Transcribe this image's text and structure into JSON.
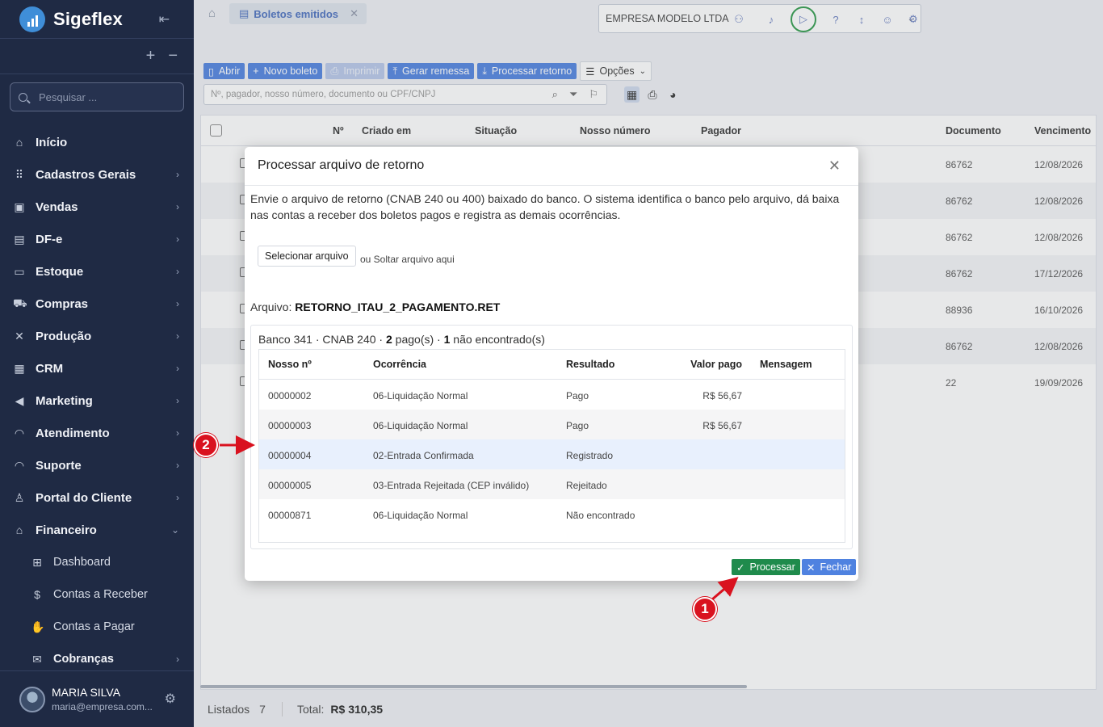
{
  "app": {
    "name": "Sigeflex"
  },
  "sidebar": {
    "search_placeholder": "Pesquisar ...",
    "items": [
      {
        "label": "Início",
        "icon": "home-icon"
      },
      {
        "label": "Cadastros Gerais",
        "icon": "grid-icon"
      },
      {
        "label": "Vendas",
        "icon": "bag-icon"
      },
      {
        "label": "DF-e",
        "icon": "document-icon"
      },
      {
        "label": "Estoque",
        "icon": "box-icon"
      },
      {
        "label": "Compras",
        "icon": "truck-icon"
      },
      {
        "label": "Produção",
        "icon": "tools-icon"
      },
      {
        "label": "CRM",
        "icon": "briefcase-icon"
      },
      {
        "label": "Marketing",
        "icon": "megaphone-icon"
      },
      {
        "label": "Atendimento",
        "icon": "headset-icon"
      },
      {
        "label": "Suporte",
        "icon": "support-icon"
      },
      {
        "label": "Portal do Cliente",
        "icon": "user-icon"
      },
      {
        "label": "Financeiro",
        "icon": "bank-icon"
      }
    ],
    "subitems": [
      {
        "label": "Dashboard",
        "icon": "dashboard-icon"
      },
      {
        "label": "Contas a Receber",
        "icon": "coin-icon"
      },
      {
        "label": "Contas a Pagar",
        "icon": "hand-coin-icon"
      },
      {
        "label": "Cobranças",
        "icon": "mail-icon"
      }
    ],
    "user": {
      "name": "MARIA SILVA",
      "email": "maria@empresa.com..."
    }
  },
  "topbar": {
    "tab_label": "Boletos emitidos",
    "company": "EMPRESA MODELO LTDA"
  },
  "toolbar": {
    "abrir": "Abrir",
    "novo_boleto": "Novo boleto",
    "imprimir": "Imprimir",
    "gerar_remessa": "Gerar remessa",
    "processar_retorno": "Processar retorno",
    "opcoes": "Opções",
    "filter_placeholder": "Nº, pagador, nosso número, documento ou CPF/CNPJ"
  },
  "grid": {
    "columns": [
      "Nº",
      "Criado em",
      "Situação",
      "Nosso número",
      "Pagador",
      "Documento",
      "Vencimento"
    ],
    "rows": [
      {
        "documento": "86762",
        "vencimento": "12/08/2026"
      },
      {
        "documento": "86762",
        "vencimento": "12/08/2026"
      },
      {
        "documento": "86762",
        "vencimento": "12/08/2026"
      },
      {
        "documento": "86762",
        "vencimento": "17/12/2026"
      },
      {
        "documento": "88936",
        "vencimento": "16/10/2026"
      },
      {
        "documento": "86762",
        "vencimento": "12/08/2026"
      },
      {
        "documento": "22",
        "vencimento": "19/09/2026"
      }
    ]
  },
  "footer": {
    "listados_label": "Listados",
    "listados_value": "7",
    "total_label": "Total:",
    "total_value": "R$ 310,35"
  },
  "dialog": {
    "title": "Processar arquivo de retorno",
    "description": "Envie o arquivo de retorno (CNAB 240 ou 400) baixado do banco. O sistema identifica o banco pelo arquivo, dá baixa nas contas a receber dos boletos pagos e registra as demais ocorrências.",
    "select_button": "Selecionar arquivo",
    "drop_text": "ou Soltar arquivo aqui",
    "arquivo_label": "Arquivo:",
    "arquivo_name": "RETORNO_ITAU_2_PAGAMENTO.RET",
    "summary_prefix": "Banco 341 · CNAB 240 · ",
    "summary_pagos": "2",
    "summary_mid": " pago(s) · ",
    "summary_nao": "1",
    "summary_suffix": " não encontrado(s)",
    "columns": [
      "Nosso nº",
      "Ocorrência",
      "Resultado",
      "Valor pago",
      "Mensagem"
    ],
    "rows": [
      {
        "nosso": "00000002",
        "ocorrencia": "06-Liquidação Normal",
        "resultado": "Pago",
        "valor": "R$ 56,67",
        "mensagem": ""
      },
      {
        "nosso": "00000003",
        "ocorrencia": "06-Liquidação Normal",
        "resultado": "Pago",
        "valor": "R$ 56,67",
        "mensagem": ""
      },
      {
        "nosso": "00000004",
        "ocorrencia": "02-Entrada Confirmada",
        "resultado": "Registrado",
        "valor": "",
        "mensagem": ""
      },
      {
        "nosso": "00000005",
        "ocorrencia": "03-Entrada Rejeitada (CEP inválido)",
        "resultado": "Rejeitado",
        "valor": "",
        "mensagem": ""
      },
      {
        "nosso": "00000871",
        "ocorrencia": "06-Liquidação Normal",
        "resultado": "Não encontrado",
        "valor": "",
        "mensagem": ""
      }
    ],
    "processar": "Processar",
    "fechar": "Fechar"
  },
  "annotations": {
    "marker_1": "1",
    "marker_2": "2"
  },
  "colors": {
    "sidebar": "#1f2a44",
    "primary": "#4f82e0",
    "success": "#1f8b4c",
    "marker": "#d9121f"
  }
}
